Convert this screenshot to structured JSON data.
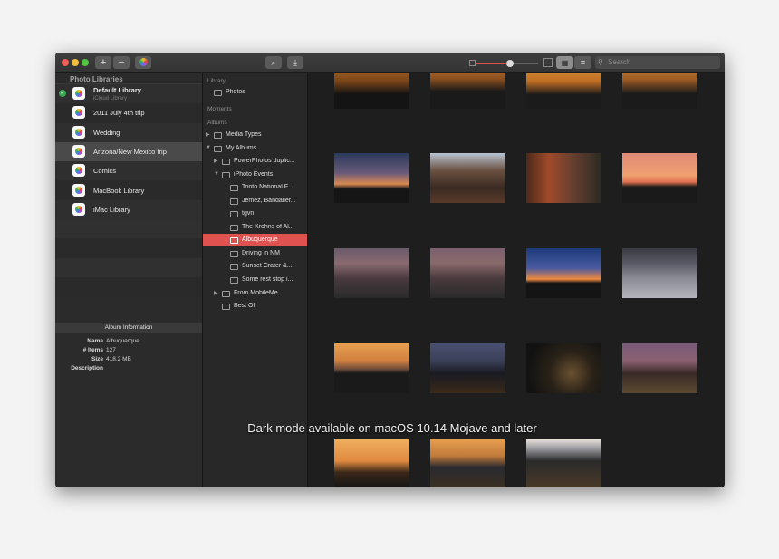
{
  "toolbar": {
    "add_label": "+",
    "remove_label": "−",
    "search_placeholder": "Search",
    "search_icon": "magnifier-icon",
    "zoom_level": 0.55
  },
  "sidebar": {
    "header": "Photo Libraries",
    "libraries": [
      {
        "name": "Default Library",
        "subtitle": "iCloud Library",
        "selected": false,
        "active": true
      },
      {
        "name": "2011 July 4th trip",
        "subtitle": "",
        "selected": false,
        "active": false
      },
      {
        "name": "Wedding",
        "subtitle": "",
        "selected": false,
        "active": false
      },
      {
        "name": "Arizona/New Mexico trip",
        "subtitle": "",
        "selected": true,
        "active": false
      },
      {
        "name": "Comics",
        "subtitle": "",
        "selected": false,
        "active": false
      },
      {
        "name": "MacBook Library",
        "subtitle": "",
        "selected": false,
        "active": false
      },
      {
        "name": "iMac Library",
        "subtitle": "",
        "selected": false,
        "active": false
      }
    ],
    "info": {
      "header": "Album Information",
      "name_label": "Name",
      "name_value": "Albuquerque",
      "items_label": "# Items",
      "items_value": "127",
      "size_label": "Size",
      "size_value": "418.2 MB",
      "description_label": "Description"
    }
  },
  "albums": {
    "sections": {
      "library": "Library",
      "moments": "Moments",
      "albums": "Albums"
    },
    "rows": [
      {
        "label": "Photos",
        "indent": 0,
        "type": "folder",
        "tri": ""
      },
      {
        "label": "Media Types",
        "indent": 0,
        "type": "folder",
        "tri": "▶"
      },
      {
        "label": "My Albums",
        "indent": 0,
        "type": "folder",
        "tri": "▼"
      },
      {
        "label": "PowerPhotos duplic...",
        "indent": 1,
        "type": "folder",
        "tri": "▶"
      },
      {
        "label": "iPhoto Events",
        "indent": 1,
        "type": "folder",
        "tri": "▼"
      },
      {
        "label": "Tonto National F...",
        "indent": 2,
        "type": "album",
        "tri": ""
      },
      {
        "label": "Jemez, Bandalier...",
        "indent": 2,
        "type": "album",
        "tri": ""
      },
      {
        "label": "tgvn",
        "indent": 2,
        "type": "album",
        "tri": ""
      },
      {
        "label": "The Krohns of Al...",
        "indent": 2,
        "type": "album",
        "tri": ""
      },
      {
        "label": "Albuquerque",
        "indent": 2,
        "type": "album",
        "tri": "",
        "selected": true
      },
      {
        "label": "Driving in NM",
        "indent": 2,
        "type": "album",
        "tri": ""
      },
      {
        "label": "Sunset Crater &...",
        "indent": 2,
        "type": "album",
        "tri": ""
      },
      {
        "label": "Some rest stop i...",
        "indent": 2,
        "type": "album",
        "tri": ""
      },
      {
        "label": "From MobileMe",
        "indent": 1,
        "type": "folder",
        "tri": "▶"
      },
      {
        "label": "Best Of",
        "indent": 1,
        "type": "album",
        "tri": ""
      }
    ]
  },
  "photos": [
    "sunset-tram-1",
    "sunset-horizon-1",
    "sunset-tram-2",
    "sunset-tram-3",
    "dusk-mountain",
    "canyon-group",
    "people-overlook",
    "pink-sunset",
    "mountain-valley-1",
    "mountain-valley-2",
    "blue-hour-horizon",
    "snowy-ridge",
    "city-dusk-1",
    "city-lights-valley",
    "city-lights-grid",
    "city-lights-pink",
    "sunset-plain",
    "city-sunset-lights",
    "city-night-lights"
  ],
  "caption": "Dark mode available on macOS 10.14 Mojave and later",
  "colors": {
    "accent": "#e0524f",
    "selection": "#4a4a4a",
    "check": "#3aa853"
  }
}
